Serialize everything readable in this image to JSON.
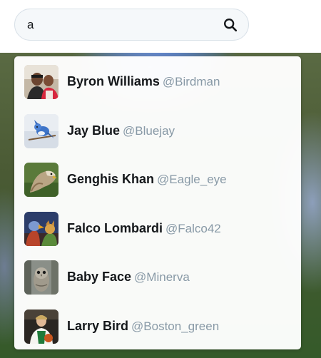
{
  "search": {
    "value": "a",
    "placeholder": ""
  },
  "results": [
    {
      "name": "Byron Williams",
      "handle": "@Birdman"
    },
    {
      "name": "Jay Blue",
      "handle": "@Bluejay"
    },
    {
      "name": "Genghis Khan",
      "handle": "@Eagle_eye"
    },
    {
      "name": "Falco Lombardi",
      "handle": "@Falco42"
    },
    {
      "name": "Baby Face",
      "handle": "@Minerva"
    },
    {
      "name": "Larry Bird",
      "handle": "@Boston_green"
    }
  ],
  "icons": {
    "search": "search-icon"
  },
  "colors": {
    "name_text": "#14171a",
    "handle_text": "#8899a6",
    "search_bg": "#f5f8fa"
  }
}
